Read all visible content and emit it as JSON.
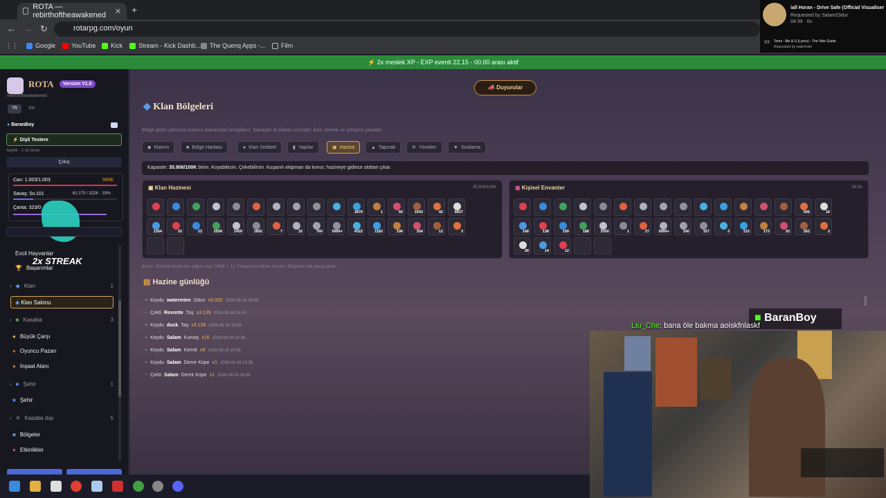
{
  "browser": {
    "tab_title": "ROTA — rebirthoftheawakened",
    "url": "rotarpg.com/oyun",
    "bookmarks": [
      "Google",
      "YouTube",
      "Kick",
      "Stream - Kick Dashb...",
      "The Quenq Apps -...",
      "Film"
    ]
  },
  "music": {
    "title": "iall Horan - Drive Safe (Official Visualiser",
    "requested": "Requested by Salam23dur",
    "time": "04:39",
    "count": "6x",
    "next_num": "#3",
    "next_title": "Toms - Me & U (Lyrics) - The Vibe Guide",
    "next_req": "Requested by watermien"
  },
  "banner": "2x meslek XP - EXP eventi 22.15 - 00.00 arası aktif",
  "sidebar": {
    "logo": "ROTA",
    "version": "Version V1.0",
    "subtitle": "rebirthoftheawakened",
    "lang_tr": "TR",
    "lang_en": "EN",
    "user": "BaranBoy",
    "profession": "Dişli Testere",
    "saved": "kayıtlı · 1 sn önce",
    "logout": "Çıkış",
    "hp": "Can: 1.003/1.003",
    "gold": "560K",
    "level": "Savaş: Sv.101",
    "xp": "62.170 / 322K · 19%",
    "bag": "Çanta: 323/0",
    "streak": "2x STREAK",
    "items": [
      {
        "label": "Evcil Hayvanlar"
      },
      {
        "label": "Başarımlar"
      }
    ],
    "sec_klan": {
      "label": "Klan",
      "count": "1"
    },
    "klan_salonu": "Klan Salonu",
    "sec_kasaba": {
      "label": "Kasaba",
      "count": "3"
    },
    "kasaba_items": [
      "Büyük Çarşı",
      "Oyuncu Pazarı",
      "İnşaat Alanı"
    ],
    "sec_sehir": {
      "label": "Şehir",
      "count": "1"
    },
    "sehir_item": "Şehir",
    "sec_kasabadisi": {
      "label": "Kasaba dışı",
      "count": "5"
    },
    "kd_items": [
      "Bölgeler",
      "Etkinlikler"
    ]
  },
  "main": {
    "announce": "Duyurular",
    "title": "Klan Bölgeleri",
    "desc": "Bölge gelini yalnızca sunucu zamanıyla hesaplanır. Savaşlar iki klanla sınırlıdır; iksir, yemek ve iyileşme yasaktır.",
    "tabs": [
      "Klanım",
      "Bölge Haritası",
      "Klan Sohbeti",
      "Yapılar",
      "Hazine",
      "Tapınak",
      "Yönetim",
      "Sıralama"
    ],
    "capacity_label": "Kapasite:",
    "capacity_value": "35.906/100K",
    "capacity_rest": "birim. Koyabilirsin. Çekebilirsin. Kuşanılı ekipman da konur; hazineye gidince slottan çıkar.",
    "treasury_title": "Klan Hazinesi",
    "treasury_count": "35.906/100K",
    "inv_title": "Kişisel Envanter",
    "inv_count": "34 tür",
    "treasury_slots": [
      "",
      "",
      "",
      "",
      "",
      "",
      "",
      "",
      "",
      "",
      "1879",
      "1",
      "50",
      "1043",
      "42",
      "6837",
      "1354",
      "33",
      "23",
      "2599",
      "1459",
      "1892",
      "7",
      "16",
      "760",
      "9999+",
      "4322",
      "1183",
      "196",
      "254",
      "12",
      "3"
    ],
    "inv_slots": [
      "",
      "",
      "",
      "",
      "",
      "",
      "",
      "",
      "",
      "",
      "",
      "",
      "",
      "",
      "506",
      "16",
      "148",
      "138",
      "199",
      "188",
      "5350",
      "1",
      "27",
      "9999+",
      "240",
      "327",
      "3",
      "215",
      "173",
      "20",
      "262",
      "2",
      "28",
      "14",
      "12"
    ],
    "tip": "İpucu: Sürükle-bırak tüm yığını taşır (Shift + 1). Tıklayınca miktar sorulur. Ekipman tek parça gider.",
    "log_title": "Hazine günlüğü",
    "logs": [
      {
        "act": "Koydu",
        "who": "watermien",
        "item": "Odun",
        "qty": "x5.000",
        "time": "2026-08-16 19:49"
      },
      {
        "act": "Çekti",
        "who": "Revonte",
        "item": "Taş",
        "qty": "x3.139",
        "time": "2026-08-16 19:43"
      },
      {
        "act": "Koydu",
        "who": "duck",
        "item": "Taş",
        "qty": "x3.139",
        "time": "2026-08-16 19:43"
      },
      {
        "act": "Koydu",
        "who": "Salam",
        "item": "Kumaş",
        "qty": "x16",
        "time": "2026-08-16 19:38"
      },
      {
        "act": "Koydu",
        "who": "Salam",
        "item": "Kemik",
        "qty": "x8",
        "time": "2026-08-16 19:38"
      },
      {
        "act": "Koydu",
        "who": "Salam",
        "item": "Demir Küpe",
        "qty": "x1",
        "time": "2026-08-16 19:38"
      },
      {
        "act": "Çekti",
        "who": "Salam",
        "item": "Demir Küpe",
        "qty": "x1",
        "time": "2026-08-16 19:38"
      }
    ]
  },
  "stream": {
    "name": "BaranBoy",
    "chat_user": "Liu_Che",
    "chat_msg": ": bana öle bakma aoiskfnlaskf"
  }
}
